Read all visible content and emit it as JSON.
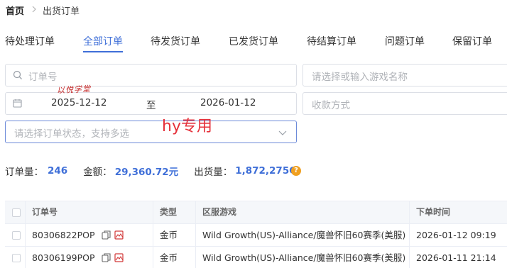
{
  "breadcrumb": {
    "home": "首页",
    "current": "出货订单"
  },
  "tabs": [
    {
      "label": "待处理订单"
    },
    {
      "label": "全部订单"
    },
    {
      "label": "待发货订单"
    },
    {
      "label": "已发货订单"
    },
    {
      "label": "待结算订单"
    },
    {
      "label": "问题订单"
    },
    {
      "label": "保留订单"
    }
  ],
  "filters": {
    "order_no_placeholder": "订单号",
    "game_placeholder": "请选择或输入游戏名称",
    "date_start": "2025-12-12",
    "date_sep": "至",
    "date_end": "2026-01-12",
    "payment_placeholder": "收款方式",
    "status_placeholder": "请选择订单状态，支持多选"
  },
  "watermarks": {
    "signature": "以悦学堂",
    "overlay": "hy专用"
  },
  "stats": {
    "count_label": "订单量：",
    "count": "246",
    "amount_label": "金额：",
    "amount": "29,360.72元",
    "qty_label": "出货量：",
    "qty": "1,872,275G"
  },
  "table": {
    "headers": [
      "订单号",
      "类型",
      "区服游戏",
      "下单时间"
    ],
    "rows": [
      {
        "order_no": "80306822POP",
        "type": "金币",
        "server": "Wild Growth(US)-Alliance/魔兽怀旧60赛季(美服)",
        "time": "2026-01-12 09:19"
      },
      {
        "order_no": "80306199POP",
        "type": "金币",
        "server": "Wild Growth(US)-Alliance/魔兽怀旧60赛季(美服)",
        "time": "2026-01-11 21:14"
      }
    ]
  },
  "colors": {
    "accent": "#3f6fd8",
    "watermark": "#e5303a",
    "help": "#f0a020"
  }
}
